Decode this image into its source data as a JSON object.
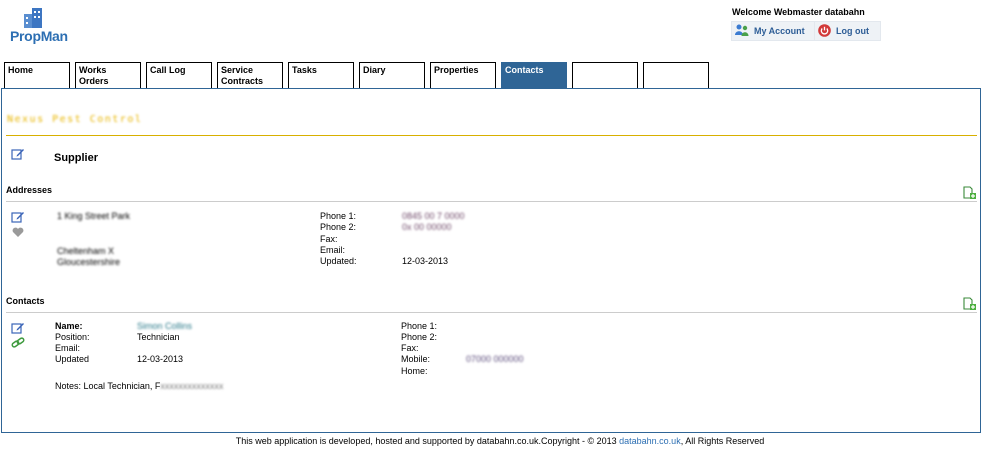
{
  "app": {
    "logo_text": "PropMan"
  },
  "header": {
    "welcome": "Welcome Webmaster databahn",
    "my_account": "My Account",
    "logout": "Log out"
  },
  "tabs": [
    {
      "line1": "Home",
      "line2": ""
    },
    {
      "line1": "Works Orders",
      "line2": ""
    },
    {
      "line1": "Call Log",
      "line2": ""
    },
    {
      "line1": "Service",
      "line2": "Contracts"
    },
    {
      "line1": "Tasks",
      "line2": ""
    },
    {
      "line1": "Diary",
      "line2": ""
    },
    {
      "line1": "Properties",
      "line2": ""
    },
    {
      "line1": "Contacts",
      "line2": ""
    },
    {
      "line1": "",
      "line2": ""
    },
    {
      "line1": "",
      "line2": ""
    }
  ],
  "page": {
    "company_name": "Nexus Pest Control",
    "type": "Supplier"
  },
  "addresses": {
    "title": "Addresses",
    "line1": "1 King Street Park",
    "line2": "Cheltenham X",
    "line3": "Gloucestershire",
    "labels": {
      "phone1": "Phone 1:",
      "phone2": "Phone 2:",
      "fax": "Fax:",
      "email": "Email:",
      "updated": "Updated:"
    },
    "values": {
      "phone1": "0845 00 7 0000",
      "phone2": "0x 00 00000",
      "fax": "",
      "email": "",
      "updated": "12-03-2013"
    }
  },
  "contacts": {
    "title": "Contacts",
    "labels": {
      "name": "Name:",
      "position": "Position:",
      "email": "Email:",
      "updated": "Updated",
      "phone1": "Phone 1:",
      "phone2": "Phone 2:",
      "fax": "Fax:",
      "mobile": "Mobile:",
      "home": "Home:"
    },
    "values": {
      "name": "Simon Collins",
      "position": "Technician",
      "email": "",
      "updated": "12-03-2013",
      "mobile": "07000 000000"
    },
    "notes_label": "Notes: Local Technician, F",
    "notes_redacted": "xxxxxxxxxxxxxx"
  },
  "footer": {
    "text_before": "This web application is developed, hosted and supported by databahn.co.uk.Copyright - © 2013 ",
    "link": "databahn.co.uk",
    "text_after": ", All Rights Reserved"
  },
  "colors": {
    "brand_blue": "#2f6596",
    "accent_gold": "#d8b000",
    "link_blue": "#2d6fb3"
  }
}
